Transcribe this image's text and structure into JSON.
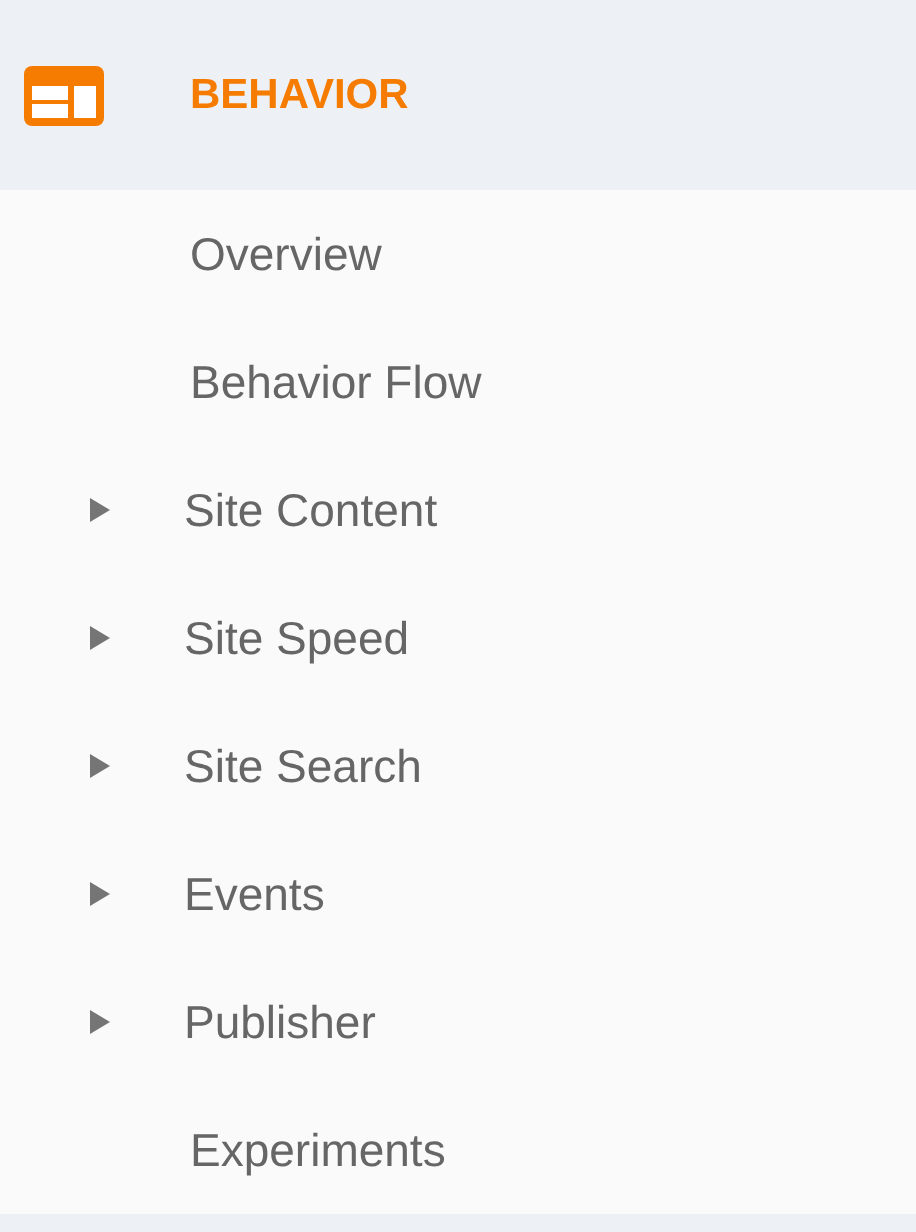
{
  "section": {
    "title": "BEHAVIOR"
  },
  "items": [
    {
      "label": "Overview",
      "kind": "link"
    },
    {
      "label": "Behavior Flow",
      "kind": "link"
    },
    {
      "label": "Site Content",
      "kind": "group",
      "expanded": false
    },
    {
      "label": "Site Speed",
      "kind": "group",
      "expanded": false
    },
    {
      "label": "Site Search",
      "kind": "group",
      "expanded": false
    },
    {
      "label": "Events",
      "kind": "group",
      "expanded": false
    },
    {
      "label": "Publisher",
      "kind": "group",
      "expanded": false
    },
    {
      "label": "Experiments",
      "kind": "link"
    }
  ]
}
